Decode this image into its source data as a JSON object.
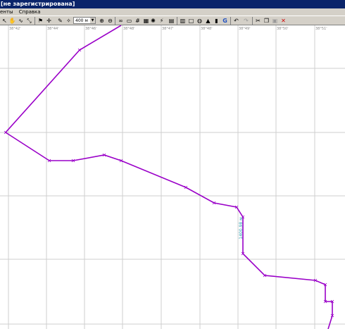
{
  "window": {
    "title": "[не зарегистрирована]"
  },
  "menu": {
    "items": [
      "енты",
      "Справка"
    ]
  },
  "toolbar": {
    "zoom_value": "400 м"
  },
  "map": {
    "longitude_labels": [
      "38°42'",
      "38°44'",
      "38°46'",
      "38°48'",
      "38°47'",
      "38°48'",
      "38°49'",
      "38°50'",
      "38°51'"
    ],
    "track_label": "1400.98 м",
    "track_color": "#9a00c8"
  }
}
